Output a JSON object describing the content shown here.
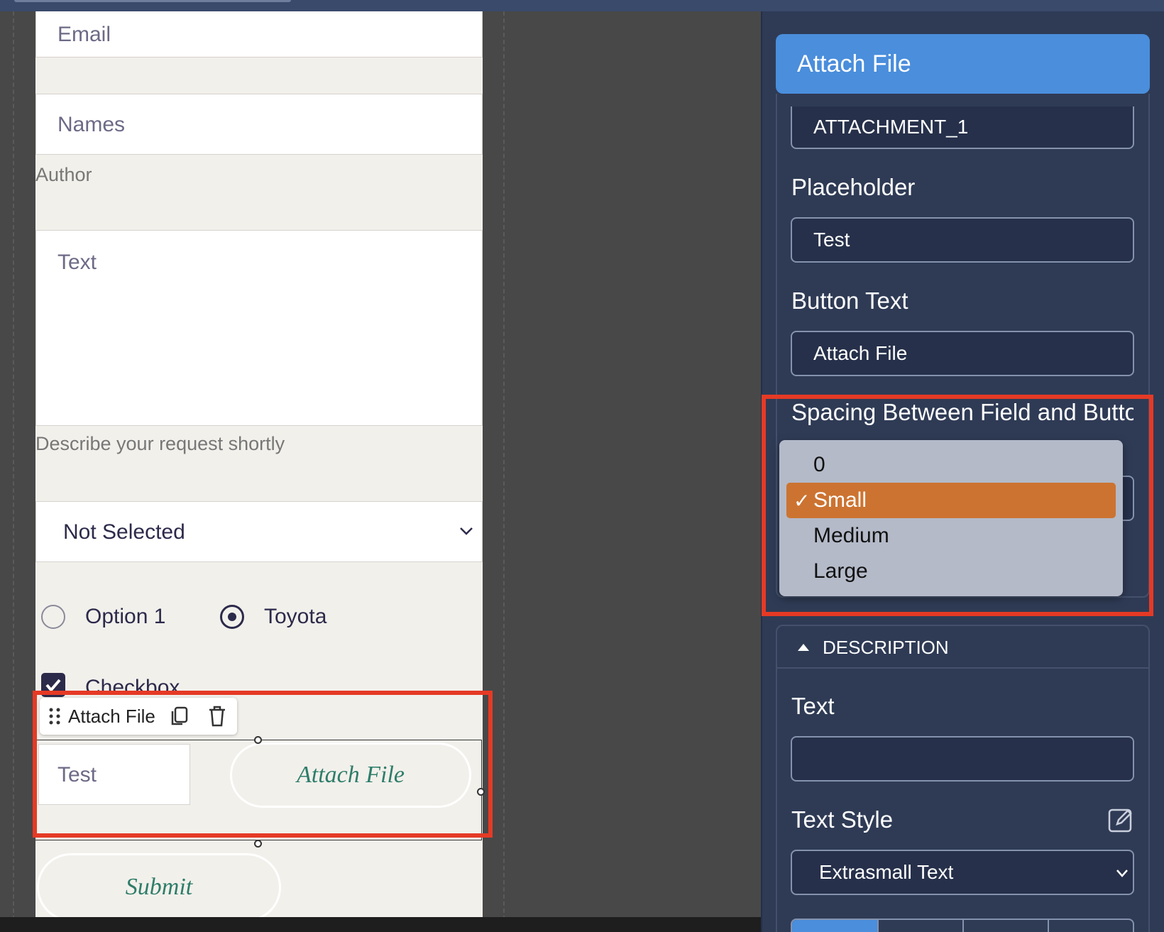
{
  "form": {
    "email_placeholder": "Email",
    "names_placeholder": "Names",
    "author_helper": "Author",
    "text_placeholder": "Text",
    "text_helper": "Describe your request shortly",
    "select_value": "Not Selected",
    "radio_options": [
      "Option 1",
      "Toyota"
    ],
    "radio_selected": "Toyota",
    "checkbox_label": "Checkbox",
    "attach_input_placeholder": "Test",
    "attach_button_label": "Attach File",
    "submit_label": "Submit"
  },
  "toolbar": {
    "label": "Attach File"
  },
  "panel": {
    "header": "Attach File",
    "name_value": "ATTACHMENT_1",
    "placeholder_label": "Placeholder",
    "placeholder_value": "Test",
    "button_text_label": "Button Text",
    "button_text_value": "Attach File",
    "spacing_label": "Spacing Between Field and Button",
    "spacing_options": [
      "0",
      "Small",
      "Medium",
      "Large"
    ],
    "spacing_selected": "Small",
    "description_section": "DESCRIPTION",
    "text_label": "Text",
    "text_value": "",
    "text_style_label": "Text Style",
    "text_style_value": "Extrasmall Text"
  },
  "colors": {
    "panel_bg": "#2f3b55",
    "header_blue": "#4a8edc",
    "highlight_red": "#e53a25",
    "menu_selected": "#cc7331",
    "button_text_green": "#2e7d6a"
  }
}
